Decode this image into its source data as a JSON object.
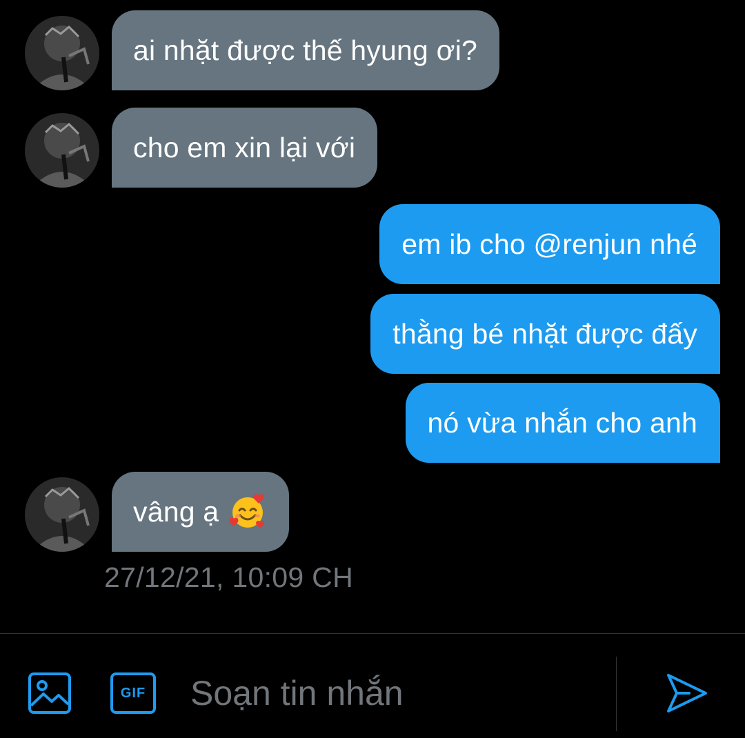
{
  "conversation": {
    "messages": [
      {
        "sender": "other",
        "text": "ai nhặt được thế hyung ơi?"
      },
      {
        "sender": "other",
        "text": "cho em xin lại với"
      },
      {
        "sender": "me",
        "text": "em ib cho @renjun nhé"
      },
      {
        "sender": "me",
        "text": "thằng bé nhặt được đấy"
      },
      {
        "sender": "me",
        "text": "nó vừa nhắn cho anh"
      },
      {
        "sender": "other",
        "text": "vâng ạ",
        "emoji": "smiling-face-with-hearts-icon"
      }
    ],
    "timestamp": "27/12/21, 10:09 CH"
  },
  "composer": {
    "placeholder": "Soạn tin nhắn",
    "gif_label": "GIF",
    "image_icon": "image-icon",
    "send_icon": "send-icon"
  },
  "colors": {
    "background": "#000000",
    "incoming_bubble": "#66757f",
    "outgoing_bubble": "#1d9bf0",
    "accent": "#1d9bf0",
    "muted_text": "#71767b"
  }
}
